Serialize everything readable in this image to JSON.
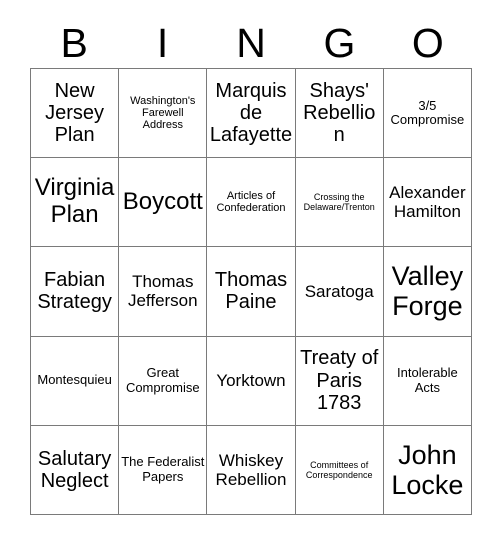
{
  "header": {
    "letters": [
      "B",
      "I",
      "N",
      "G",
      "O"
    ]
  },
  "grid": {
    "rows": [
      [
        {
          "text": "New Jersey Plan",
          "size": "fs-lg"
        },
        {
          "text": "Washington's Farewell Address",
          "size": "fs-xs"
        },
        {
          "text": "Marquis de Lafayette",
          "size": "fs-lg"
        },
        {
          "text": "Shays' Rebellion",
          "size": "fs-lg"
        },
        {
          "text": "3/5 Compromise",
          "size": "fs-sm"
        }
      ],
      [
        {
          "text": "Virginia Plan",
          "size": "fs-xl"
        },
        {
          "text": "Boycott",
          "size": "fs-xl"
        },
        {
          "text": "Articles of Confederation",
          "size": "fs-xs"
        },
        {
          "text": "Crossing the Delaware/Trenton",
          "size": "fs-xxs"
        },
        {
          "text": "Alexander Hamilton",
          "size": "fs-md"
        }
      ],
      [
        {
          "text": "Fabian Strategy",
          "size": "fs-lg"
        },
        {
          "text": "Thomas Jefferson",
          "size": "fs-md"
        },
        {
          "text": "Thomas Paine",
          "size": "fs-lg"
        },
        {
          "text": "Saratoga",
          "size": "fs-md"
        },
        {
          "text": "Valley Forge",
          "size": "fs-xxl"
        }
      ],
      [
        {
          "text": "Montesquieu",
          "size": "fs-sm"
        },
        {
          "text": "Great Compromise",
          "size": "fs-sm"
        },
        {
          "text": "Yorktown",
          "size": "fs-md"
        },
        {
          "text": "Treaty of Paris 1783",
          "size": "fs-lg"
        },
        {
          "text": "Intolerable Acts",
          "size": "fs-sm"
        }
      ],
      [
        {
          "text": "Salutary Neglect",
          "size": "fs-lg"
        },
        {
          "text": "The Federalist Papers",
          "size": "fs-sm"
        },
        {
          "text": "Whiskey Rebellion",
          "size": "fs-md"
        },
        {
          "text": "Committees of Correspondence",
          "size": "fs-xxs"
        },
        {
          "text": "John Locke",
          "size": "fs-xxl"
        }
      ]
    ]
  }
}
